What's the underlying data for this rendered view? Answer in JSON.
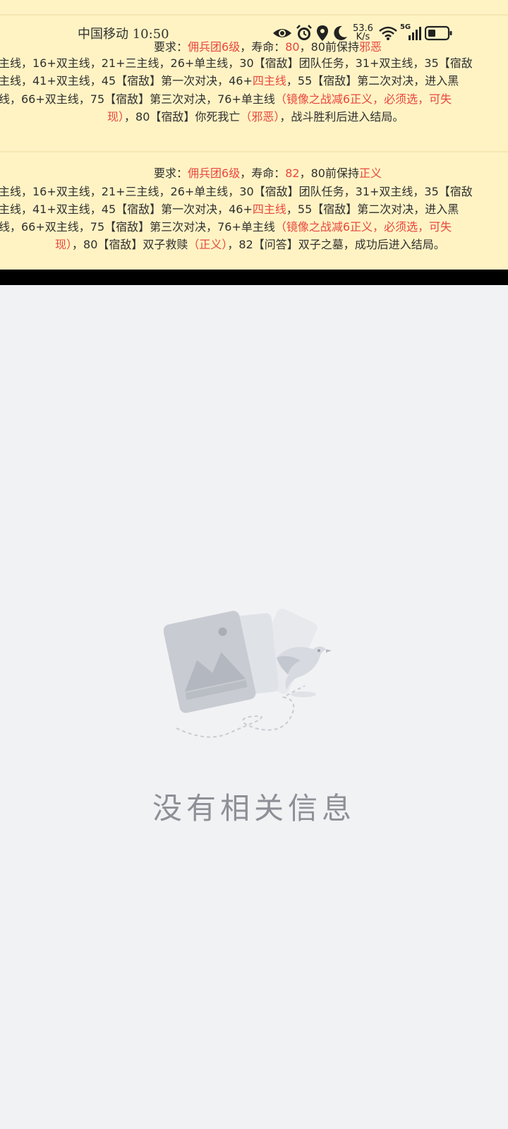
{
  "status_bar": {
    "carrier_time": "中国移动 10:50",
    "net_speed_value": "53.6",
    "net_speed_unit": "K/s",
    "network_type": "5G",
    "icons": [
      "eye-icon",
      "alarm-icon",
      "location-icon",
      "moon-icon",
      "wifi-icon",
      "signal-icon",
      "battery-icon"
    ]
  },
  "block1": {
    "req_prefix": "要求：",
    "req_group": "佣兵团6级",
    "req_mid": "，寿命：",
    "req_life": "80",
    "req_mid2": "，80前保持",
    "req_align": "邪恶",
    "line2": "主线，16+双主线，21+三主线，26+单主线，30【宿敌】团队任务，31+双主线，35【宿敌",
    "line3_a": "主线，41+双主线，45【宿敌】第一次对决，46+",
    "line3_red": "四主线",
    "line3_b": "，55【宿敌】第二次对决，进入黑",
    "line4_a": "线，66+双主线，75【宿敌】第三次对决，76+单主线",
    "line4_red": "（镜像之战减6正义，必须选，可失",
    "line5_red1": "现）",
    "line5_a": "，80【宿敌】你死我亡",
    "line5_red2": "（邪恶）",
    "line5_b": "，战斗胜利后进入结局。"
  },
  "block2": {
    "req_prefix": "要求：",
    "req_group": "佣兵团6级",
    "req_mid": "，寿命：",
    "req_life": "82",
    "req_mid2": "，80前保持",
    "req_align": "正义",
    "line2": "主线，16+双主线，21+三主线，26+单主线，30【宿敌】团队任务，31+双主线，35【宿敌",
    "line3_a": "主线，41+双主线，45【宿敌】第一次对决，46+",
    "line3_red": "四主线",
    "line3_b": "，55【宿敌】第二次对决，进入黑",
    "line4_a": "线，66+双主线，75【宿敌】第三次对决，76+单主线",
    "line4_red": "（镜像之战减6正义，必须选，可失",
    "line5_red1": "现）",
    "line5_a": "，80【宿敌】双子救赎",
    "line5_red2": "（正义）",
    "line5_b": "，82【问答】双子之墓，成功后进入结局。"
  },
  "empty_state": {
    "illustration_icon": "empty-picture-bird-icon",
    "message": "没有相关信息"
  }
}
